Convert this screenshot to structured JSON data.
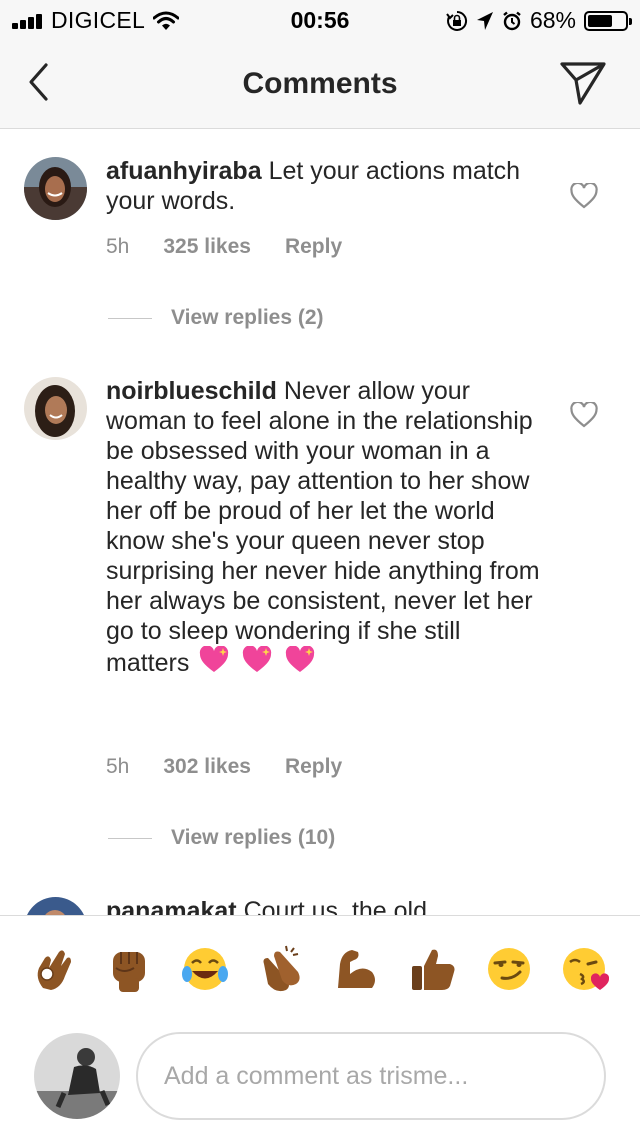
{
  "status_bar": {
    "carrier": "DIGICEL",
    "time": "00:56",
    "battery": "68%",
    "battery_level": 0.68,
    "icons": [
      "signal-bars-icon",
      "wifi-icon",
      "orientation-lock-icon",
      "location-arrow-icon",
      "alarm-icon",
      "battery-icon"
    ]
  },
  "nav": {
    "title": "Comments",
    "back_icon": "chevron-left-icon",
    "direct_icon": "paper-plane-icon"
  },
  "comments": [
    {
      "username": "afuanhyiraba",
      "text": "Let your actions match your words.",
      "time": "5h",
      "likes": "325 likes",
      "reply": "Reply",
      "view_replies": "View replies (2)"
    },
    {
      "username": "noirblueschild",
      "text": "Never allow your woman to feel alone in the relationship be obsessed with your woman in a healthy way, pay attention to her show her off be proud of her let the world know she's your queen never stop surprising her never hide anything from her always be consistent, never let her go to sleep wondering if she still matters",
      "emojis": [
        "sparkling-heart-icon",
        "sparkling-heart-icon",
        "sparkling-heart-icon"
      ],
      "time": "5h",
      "likes": "302 likes",
      "reply": "Reply",
      "view_replies": "View replies (10)"
    },
    {
      "username": "panamakat",
      "text": "Court us, the old"
    }
  ],
  "emoji_bar": [
    "ok-hand-icon",
    "raised-fist-icon",
    "tears-of-joy-icon",
    "clapping-hands-icon",
    "flexed-biceps-icon",
    "thumbs-up-icon",
    "smirking-face-icon",
    "face-blowing-kiss-icon"
  ],
  "composer": {
    "placeholder": "Add a comment as trisme..."
  },
  "colors": {
    "text": "#262626",
    "secondary": "#8e8e8e",
    "divider": "#dbdbdb",
    "bar_bg": "#f7f7f7",
    "heart_outline": "#8e8e8e"
  }
}
